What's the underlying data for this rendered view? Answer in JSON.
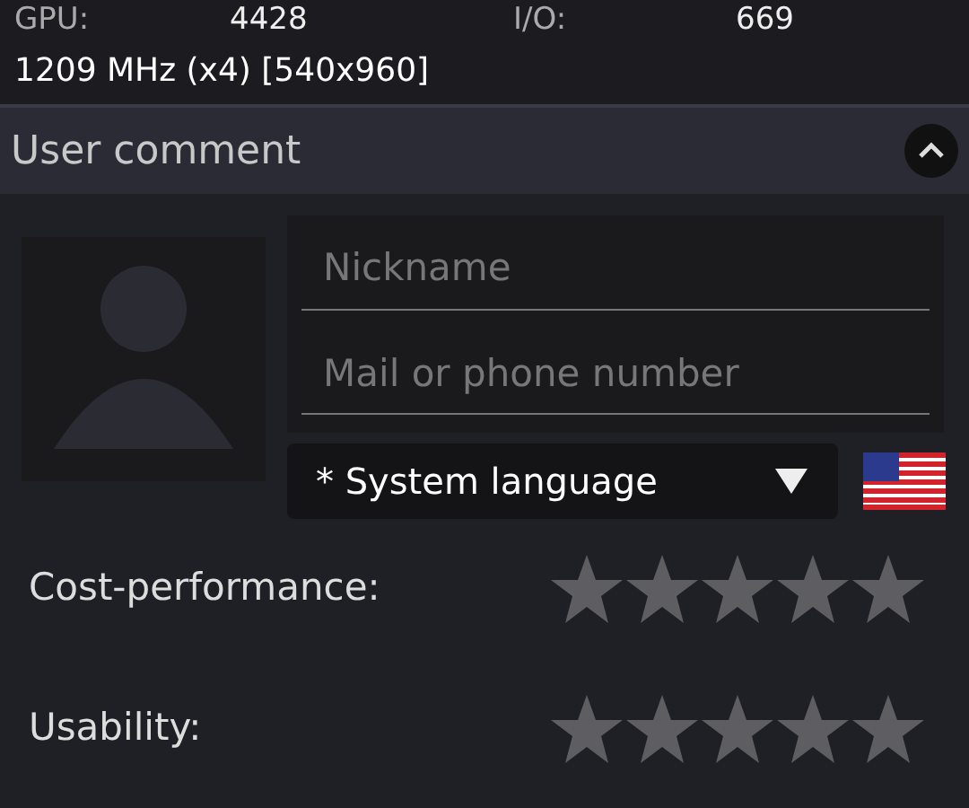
{
  "specs": [
    {
      "label": "GPU:",
      "value": "4428"
    },
    {
      "label": "I/O:",
      "value": "669"
    }
  ],
  "cpu_line": "1209 MHz (x4) [540x960]",
  "section": {
    "title": "User comment",
    "expanded": true
  },
  "form": {
    "nickname": {
      "placeholder": "Nickname"
    },
    "contact": {
      "placeholder": "Mail or phone number"
    },
    "language": {
      "value": "* System language"
    }
  },
  "ratings": [
    {
      "label": "Cost-performance:",
      "stars": 0
    },
    {
      "label": "Usability:",
      "stars": 0
    }
  ]
}
